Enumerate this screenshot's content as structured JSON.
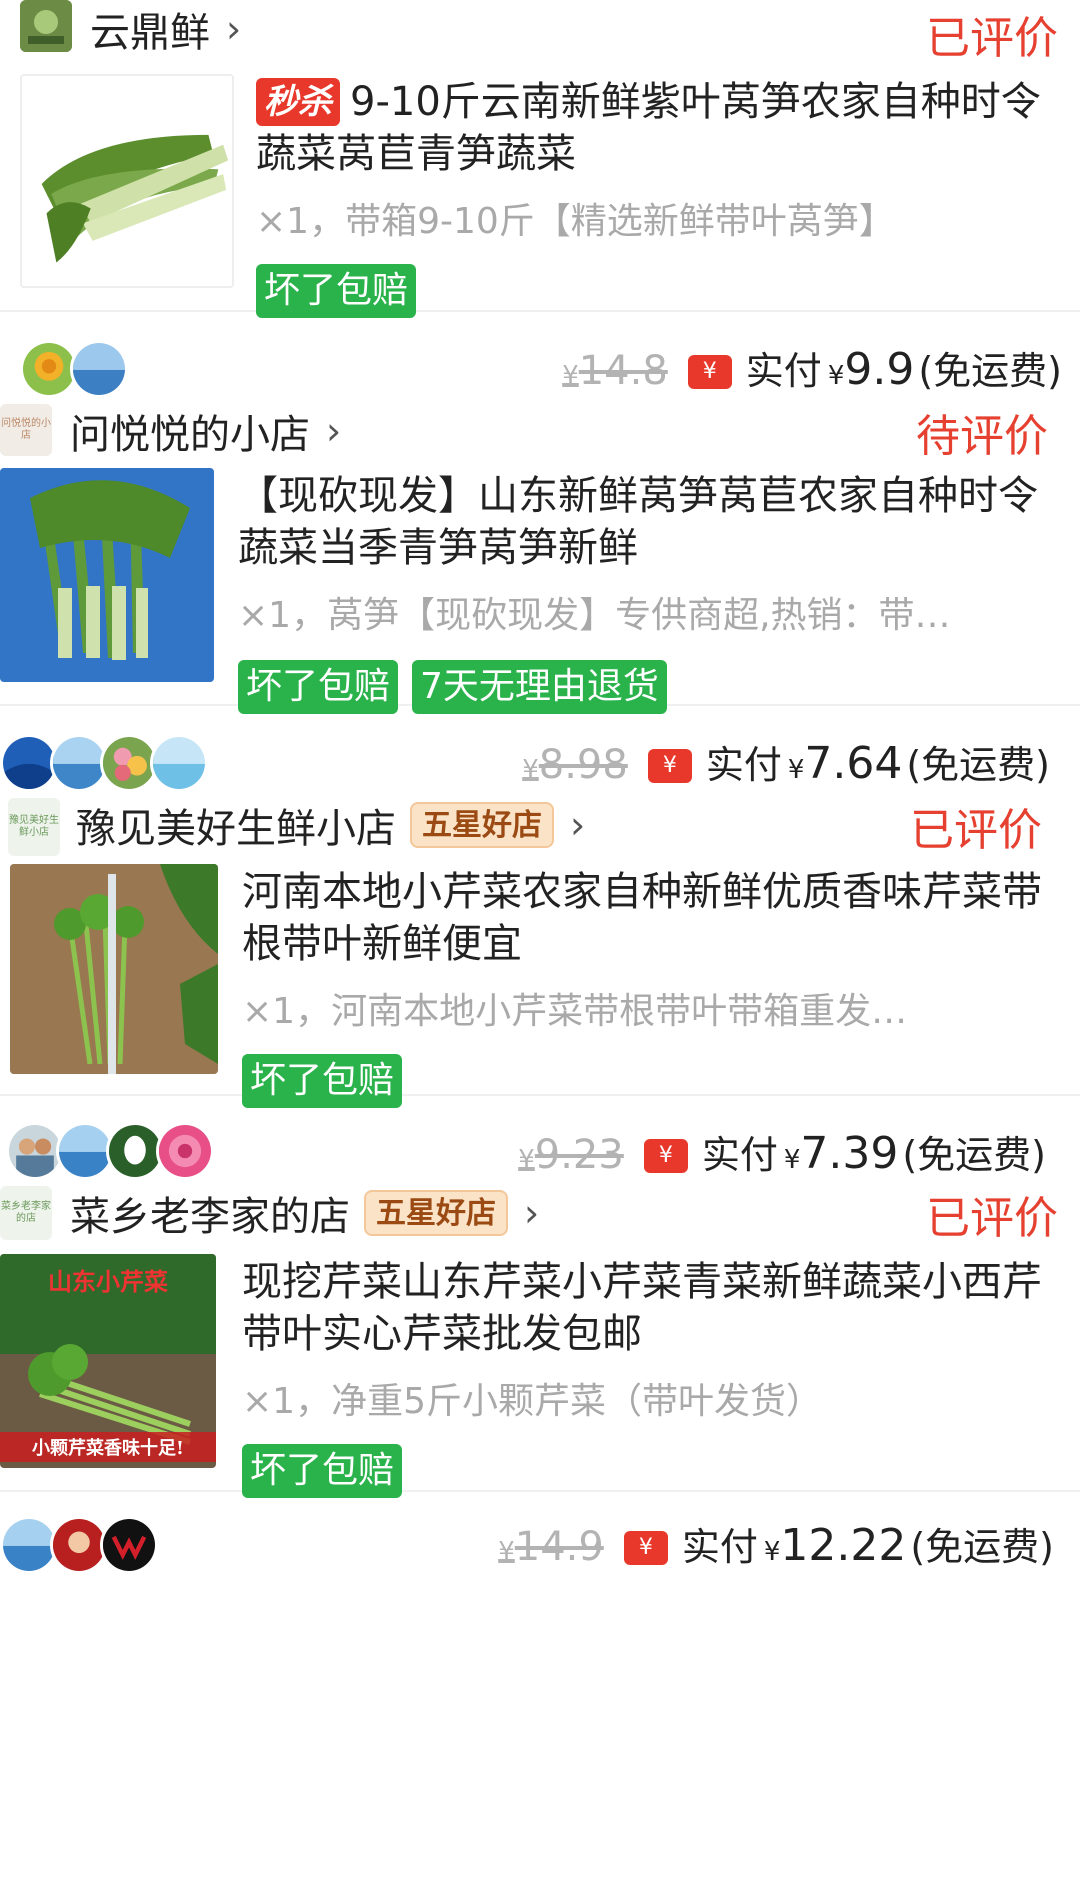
{
  "orders": [
    {
      "store_name": "云鼎鲜",
      "status": "已评价",
      "title_badge": "秒杀",
      "title": "9-10斤云南新鲜紫叶莴笋农家自种时令蔬菜莴苣青笋蔬菜",
      "spec": "×1，带箱9-10斤【精选新鲜带叶莴笋】",
      "tags": [
        "坏了包赔"
      ]
    },
    {
      "original_price": "14.8",
      "paid_label": "实付",
      "paid_amount": "9.9",
      "shipping": "(免运费)",
      "store_logo_text": "问悦悦的小店",
      "store_name": "问悦悦的小店",
      "status": "待评价",
      "title": "【现砍现发】山东新鲜莴笋莴苣农家自种时令蔬菜当季青笋莴笋新鲜",
      "spec": "×1，莴笋【现砍现发】专供商超,热销：带…",
      "tags": [
        "坏了包赔",
        "7天无理由退货"
      ]
    },
    {
      "original_price": "8.98",
      "paid_label": "实付",
      "paid_amount": "7.64",
      "shipping": "(免运费)",
      "store_logo_text": "豫见美好生鲜小店",
      "store_name": "豫见美好生鲜小店",
      "store_badge": "五星好店",
      "status": "已评价",
      "title": "河南本地小芹菜农家自种新鲜优质香味芹菜带根带叶新鲜便宜",
      "spec": "×1，河南本地小芹菜带根带叶带箱重发…",
      "tags": [
        "坏了包赔"
      ]
    },
    {
      "original_price": "9.23",
      "paid_label": "实付",
      "paid_amount": "7.39",
      "shipping": "(免运费)",
      "store_logo_text": "菜乡老李家的店",
      "store_name": "菜乡老李家的店",
      "store_badge": "五星好店",
      "status": "已评价",
      "thumb_caption_top": "山东小芹菜",
      "thumb_caption_bottom": "小颗芹菜香味十足!",
      "title": "现挖芹菜山东芹菜小芹菜青菜新鲜蔬菜小西芹带叶实心芹菜批发包邮",
      "spec": "×1，净重5斤小颗芹菜（带叶发货）",
      "tags": [
        "坏了包赔"
      ]
    },
    {
      "original_price": "14.9",
      "paid_label": "实付",
      "paid_amount": "12.22",
      "shipping": "(免运费)"
    }
  ],
  "currency": "¥",
  "red_pack_glyph": "¥",
  "chevron": "›",
  "colors": {
    "status": "#e64030",
    "tag_green": "#2ab24b",
    "flash_red": "#e8382b"
  }
}
